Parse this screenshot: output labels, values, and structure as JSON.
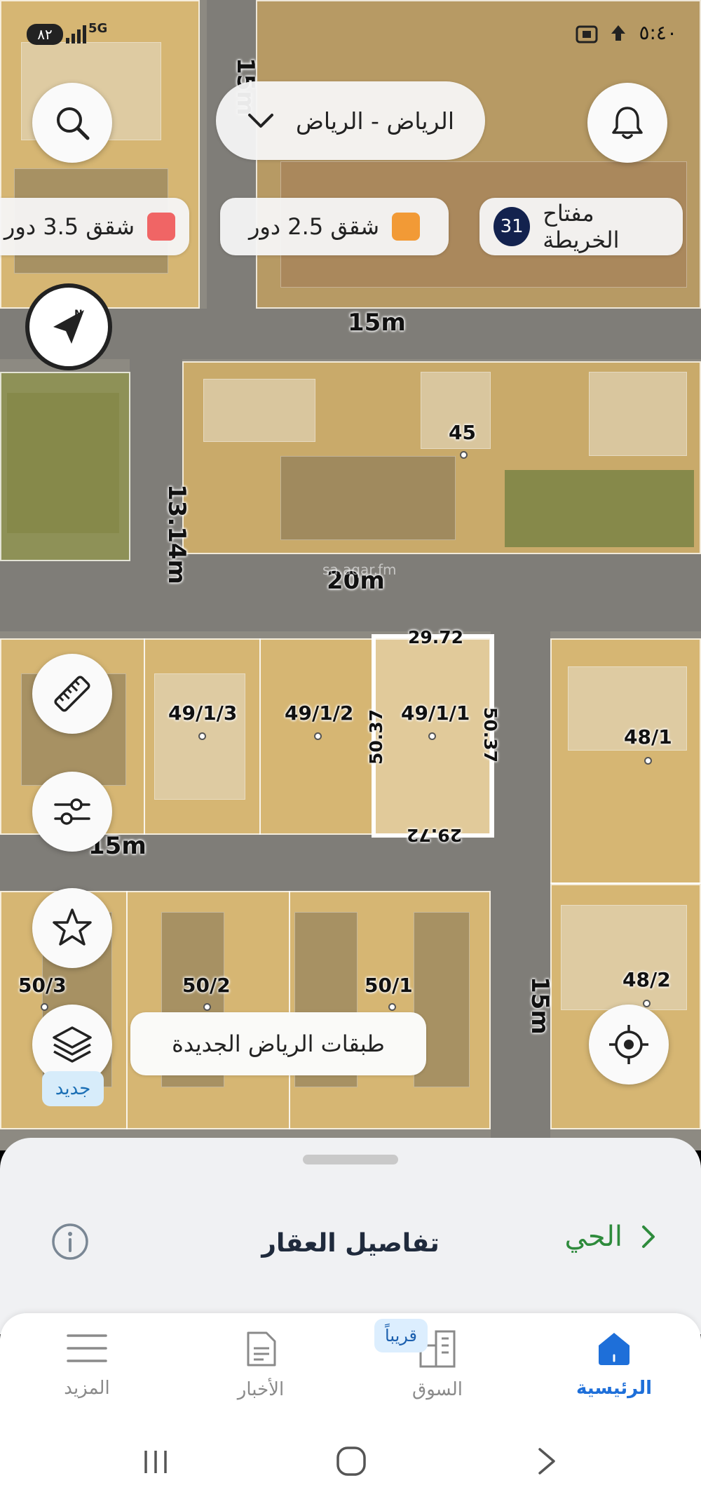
{
  "status_bar": {
    "time": "٥:٤٠",
    "battery": "٨٢",
    "network": "5G"
  },
  "header": {
    "city": "الرياض - الرياض"
  },
  "legend": {
    "map_key_label": "مفتاح الخريطة",
    "map_key_count": "31",
    "items": [
      {
        "label": "شقق 2.5 دور",
        "color": "#f29a36"
      },
      {
        "label": "شقق 3.5 دور",
        "color": "#f06565"
      }
    ]
  },
  "map": {
    "road_labels": [
      "15m",
      "15m",
      "20m",
      "13.14m",
      "15m",
      "15m"
    ],
    "plot_labels": [
      "45",
      "49/1/3",
      "49/1/2",
      "49/1/1",
      "48/1",
      "50/3",
      "50/2",
      "50/1",
      "48/2"
    ],
    "selected_plot": {
      "top_side": "29.72",
      "bottom_side": "29.72",
      "left_side": "50.37",
      "right_side": "50.37"
    },
    "watermark": "sa.aqar.fm"
  },
  "layers": {
    "label": "طبقات الرياض الجديدة",
    "new_badge": "جديد"
  },
  "sheet": {
    "title": "تفاصيل العقار",
    "link": "الحي"
  },
  "nav": {
    "items": [
      {
        "label": "الرئيسية",
        "icon": "home-icon",
        "active": true
      },
      {
        "label": "السوق",
        "icon": "market-icon",
        "active": false
      },
      {
        "label": "الأخبار",
        "icon": "news-icon",
        "active": false
      },
      {
        "label": "المزيد",
        "icon": "menu-icon",
        "active": false
      }
    ],
    "soon_badge": "قريباً"
  },
  "colors": {
    "accent": "#1e6fd9",
    "link_green": "#2e8b3c",
    "title_dark": "#1f2a3c"
  }
}
